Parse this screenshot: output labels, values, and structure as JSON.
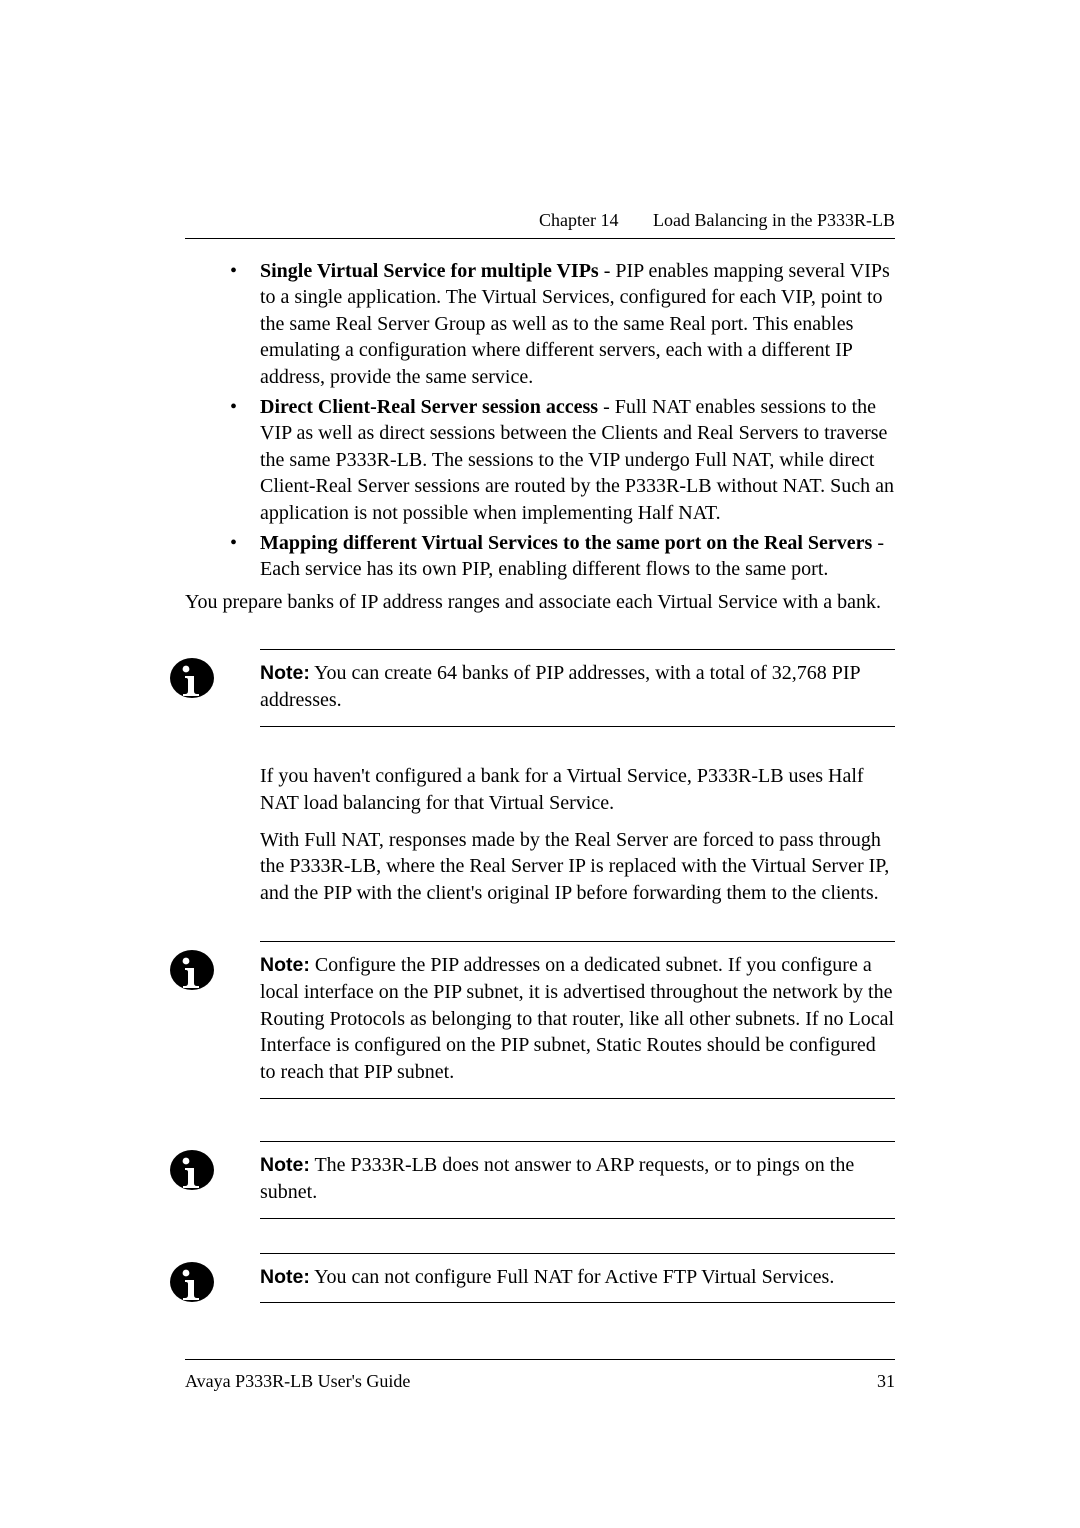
{
  "header": {
    "chapter": "Chapter 14",
    "title": "Load Balancing in the P333R-LB"
  },
  "bullets": [
    {
      "bold": "Single Virtual Service for multiple VIPs",
      "rest": " - PIP enables mapping several VIPs to a single application. The Virtual Services, configured for each VIP, point to the same Real Server Group as well as to the same Real port. This enables emulating a configuration where different servers, each with a different IP address, provide the same service."
    },
    {
      "bold": "Direct Client-Real Server session access",
      "rest": " - Full NAT enables sessions to the VIP as well as direct sessions between the Clients and Real Servers to traverse the same P333R-LB. The sessions to the VIP undergo Full NAT, while direct Client-Real Server sessions are routed by the P333R-LB without NAT. Such an application is not possible when implementing Half NAT."
    },
    {
      "bold": "Mapping different Virtual Services to the same port on the Real Servers",
      "rest": " - Each service has its own PIP, enabling different flows to the same port."
    }
  ],
  "para_after_bullets": "You prepare banks of IP address ranges and associate each Virtual Service with a bank.",
  "notes": [
    {
      "label": "Note:",
      "text": "  You can create 64 banks of PIP addresses, with a total of 32,768 PIP addresses."
    },
    {
      "label": "Note:",
      "text": "  Configure the PIP addresses on a dedicated subnet. If you configure a local interface on the PIP subnet, it is advertised throughout the network by the Routing Protocols as belonging to that router, like all other subnets. If no Local Interface is configured on the PIP subnet, Static Routes should be configured to reach that PIP subnet."
    },
    {
      "label": "Note:",
      "text": "  The P333R-LB does not answer to ARP requests, or to pings on the subnet."
    },
    {
      "label": "Note:",
      "text": "  You can not configure Full NAT for Active FTP Virtual Services."
    }
  ],
  "between_paras": [
    "If you haven't configured a bank for a Virtual Service, P333R-LB uses Half NAT load balancing for that Virtual Service.",
    "With Full NAT, responses made by the Real Server are forced to pass through the P333R-LB, where the Real Server IP is replaced with the Virtual Server IP, and the PIP with the client's original IP before forwarding them to the clients."
  ],
  "footer": {
    "left": "Avaya P333R-LB User's Guide",
    "right": "31"
  },
  "icon_name": "info-icon"
}
